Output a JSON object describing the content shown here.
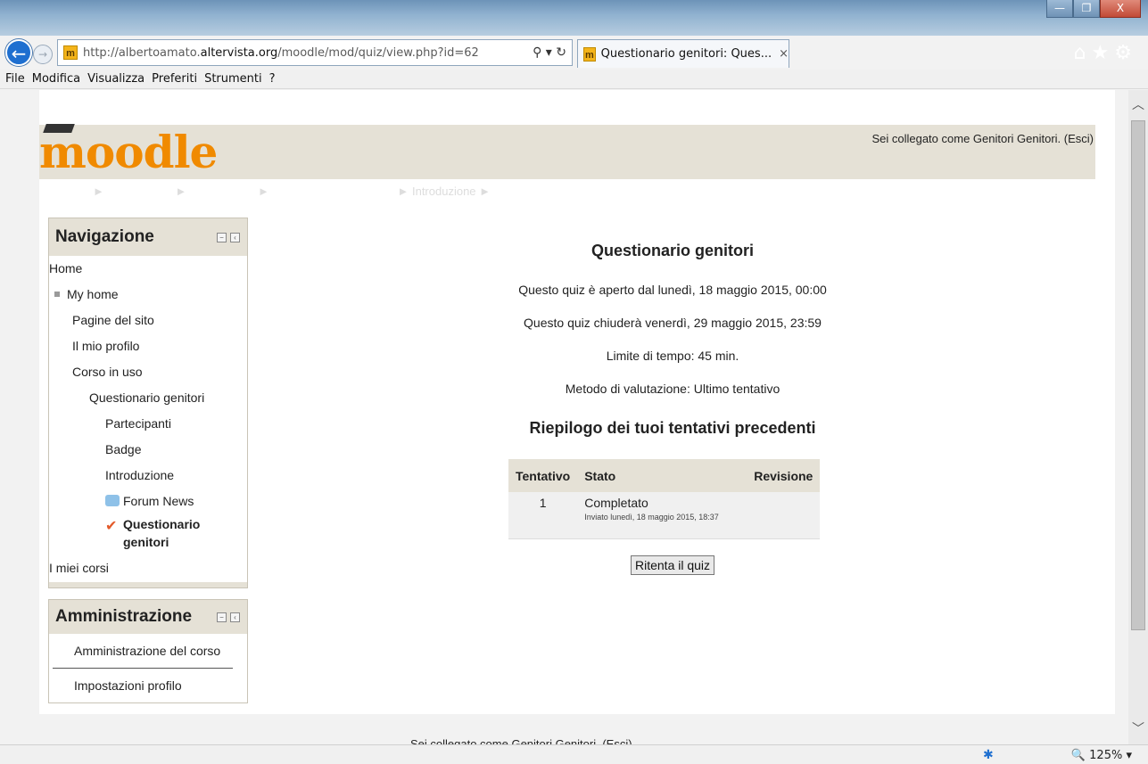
{
  "browser": {
    "url_prefix": "http://albertoamato.",
    "url_domain": "altervista.org",
    "url_path": "/moodle/mod/quiz/view.php?id=62",
    "tab_title": "Questionario genitori: Ques...",
    "tab_close": "×",
    "addr_icons": "⚲ ▾ ↻",
    "right_icons": "⌂★⚙",
    "window_buttons": {
      "minimize": "—",
      "maximize": "❐",
      "close": "X"
    }
  },
  "menubar": [
    "File",
    "Modifica",
    "Visualizza",
    "Preferiti",
    "Strumenti",
    "?"
  ],
  "site": {
    "logo_text": "moodle",
    "login_info": "Sei collegato come Genitori Genitori. (Esci)",
    "breadcrumb": [
      "►",
      "►",
      "►",
      "► Introduzione ►"
    ]
  },
  "navigation": {
    "title": "Navigazione",
    "items": [
      "Home",
      "My home",
      "Pagine del sito",
      "Il mio profilo",
      "Corso in uso",
      "Questionario genitori",
      "Partecipanti",
      "Badge",
      "Introduzione",
      "Forum News",
      "Questionario",
      "genitori",
      "I miei corsi"
    ]
  },
  "administration": {
    "title": "Amministrazione",
    "items": [
      "Amministrazione del corso",
      "Impostazioni profilo"
    ]
  },
  "quiz": {
    "title": "Questionario genitori",
    "open": "Questo quiz è aperto dal lunedì, 18 maggio 2015, 00:00",
    "close": "Questo quiz chiuderà venerdì, 29 maggio 2015, 23:59",
    "time_limit": "Limite di tempo: 45 min.",
    "grading": "Metodo di valutazione: Ultimo tentativo",
    "summary_title": "Riepilogo dei tuoi tentativi precedenti",
    "table_headers": [
      "Tentativo",
      "Stato",
      "Revisione"
    ],
    "attempt": {
      "number": "1",
      "state": "Completato",
      "submitted": "Inviato lunedì, 18 maggio 2015, 18:37",
      "review": ""
    },
    "retry_button": "Ritenta il quiz"
  },
  "footer": {
    "login_info": "Sei collegato come Genitori Genitori. (Esci)"
  },
  "status": {
    "zoom": "125%",
    "zoom_icon": "🔍",
    "zoom_arrow": "▾"
  }
}
